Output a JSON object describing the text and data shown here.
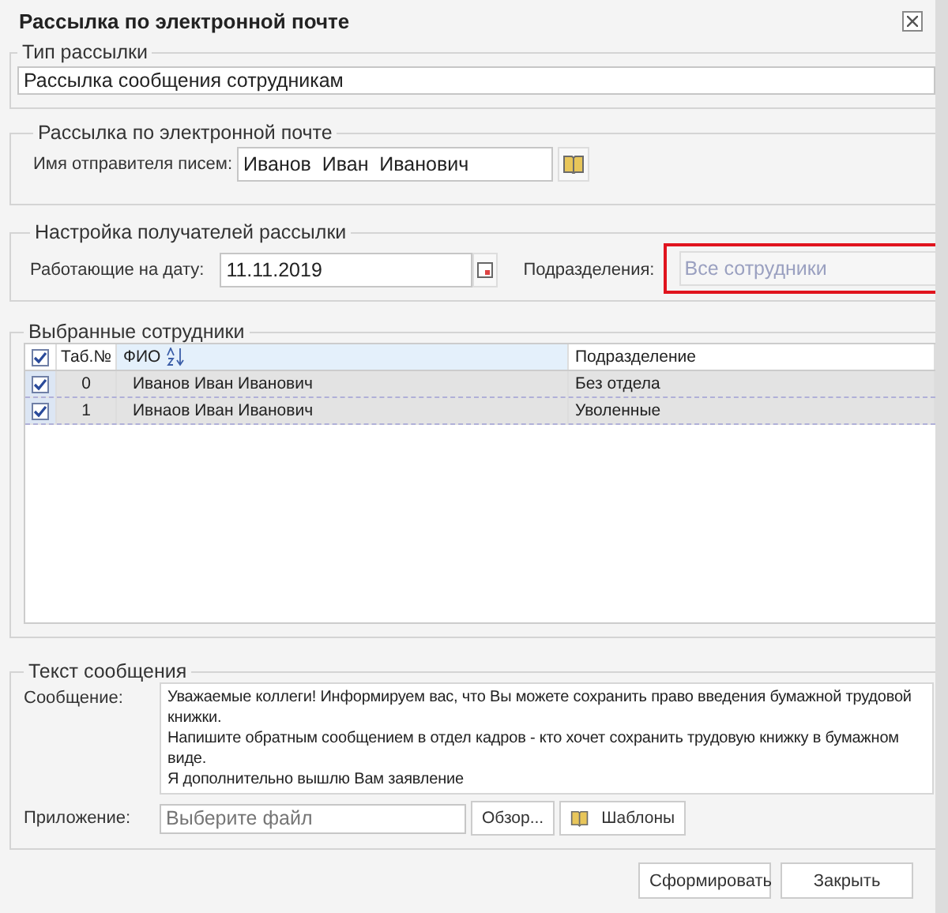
{
  "window": {
    "title": "Рассылка по электронной почте"
  },
  "mailing_type": {
    "legend": "Тип рассылки",
    "value": "Рассылка сообщения сотрудникам"
  },
  "email": {
    "legend": "Рассылка по электронной почте",
    "sender_label": "Имя отправителя писем:",
    "sender_value": "Иванов  Иван  Иванович"
  },
  "recipients": {
    "legend": "Настройка получателей рассылки",
    "date_label": "Работающие на дату:",
    "date_value": "11.11.2019",
    "department_label": "Подразделения:",
    "department_placeholder": "Все сотрудники",
    "department_highlighted": true
  },
  "employees": {
    "legend": "Выбранные сотрудники",
    "all_checked": true,
    "columns": [
      "Таб.№",
      "ФИО",
      "Подразделение"
    ],
    "rows": [
      {
        "number": "0",
        "name": "Иванов Иван Иванович",
        "department": "Без отдела",
        "checked": true
      },
      {
        "number": "1",
        "name": "Ивнаов Иван Иванович",
        "department": "Уволенные",
        "checked": true
      }
    ]
  },
  "message": {
    "legend": "Текст сообщения",
    "message_label": "Сообщение:",
    "message_value": "Уважаемые коллеги! Информируем вас, что Вы можете сохранить право введения бумажной трудовой книжки.\nНапишите обратным сообщением в отдел кадров - кто хочет сохранить трудовую книжку в бумажном виде.\nЯ дополнительно вышлю Вам заявление",
    "attachment_label": "Приложение:",
    "attachment_placeholder": "Выберите файл",
    "browse_button": "Обзор...",
    "templates_button": "Шаблоны"
  },
  "buttons": [
    "Сформировать",
    "Закрыть"
  ]
}
